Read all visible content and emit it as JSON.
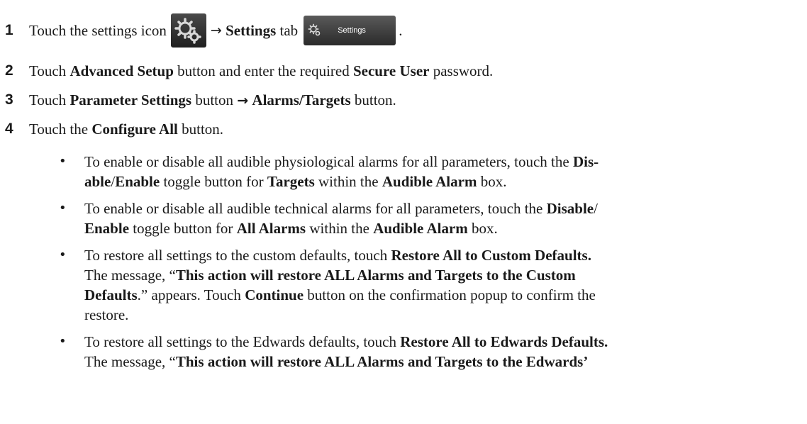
{
  "steps": [
    {
      "num": "1",
      "parts": [
        "Touch the settings icon",
        "→",
        "Settings",
        "tab",
        "."
      ]
    },
    {
      "num": "2",
      "parts": [
        "Touch ",
        "Advanced Setup",
        " button and enter the required ",
        "Secure User",
        " password."
      ]
    },
    {
      "num": "3",
      "parts": [
        "Touch ",
        "Parameter Settings",
        " button ",
        "→",
        " ",
        "Alarms/Targets",
        " button."
      ]
    },
    {
      "num": "4",
      "parts": [
        "Touch the ",
        "Configure All",
        " button."
      ]
    }
  ],
  "tab_button": {
    "label": "Settings"
  },
  "icons": {
    "settings": "gear-icon",
    "settings_tab": "gear-icon"
  },
  "bullets": [
    {
      "lines": [
        [
          "To enable or disable all audible physiological alarms for all parameters, touch the ",
          "Dis-"
        ],
        [
          "able",
          "/",
          "Enable",
          " toggle button for ",
          "Targets",
          " within the ",
          "Audible Alarm",
          " box."
        ]
      ]
    },
    {
      "lines": [
        [
          "To enable or disable all audible technical alarms for all parameters, touch the ",
          "Disable",
          "/"
        ],
        [
          "Enable",
          " toggle button for ",
          "All Alarms",
          " within the ",
          "Audible Alarm",
          " box."
        ]
      ]
    },
    {
      "lines": [
        [
          "To restore all settings to the custom defaults, touch ",
          "Restore All to Custom Defaults."
        ],
        [
          "The message, “",
          "This action will restore ALL Alarms and Targets to the Custom"
        ],
        [
          "Defaults",
          ".” appears. Touch ",
          "Continue",
          " button on the confirmation popup to confirm the"
        ],
        [
          "restore."
        ]
      ]
    },
    {
      "lines": [
        [
          "To restore all settings to the Edwards defaults, touch ",
          "Restore All to Edwards Defaults."
        ],
        [
          "The message, “",
          "This action will restore ALL Alarms and Targets to the Edwards’"
        ]
      ]
    }
  ]
}
